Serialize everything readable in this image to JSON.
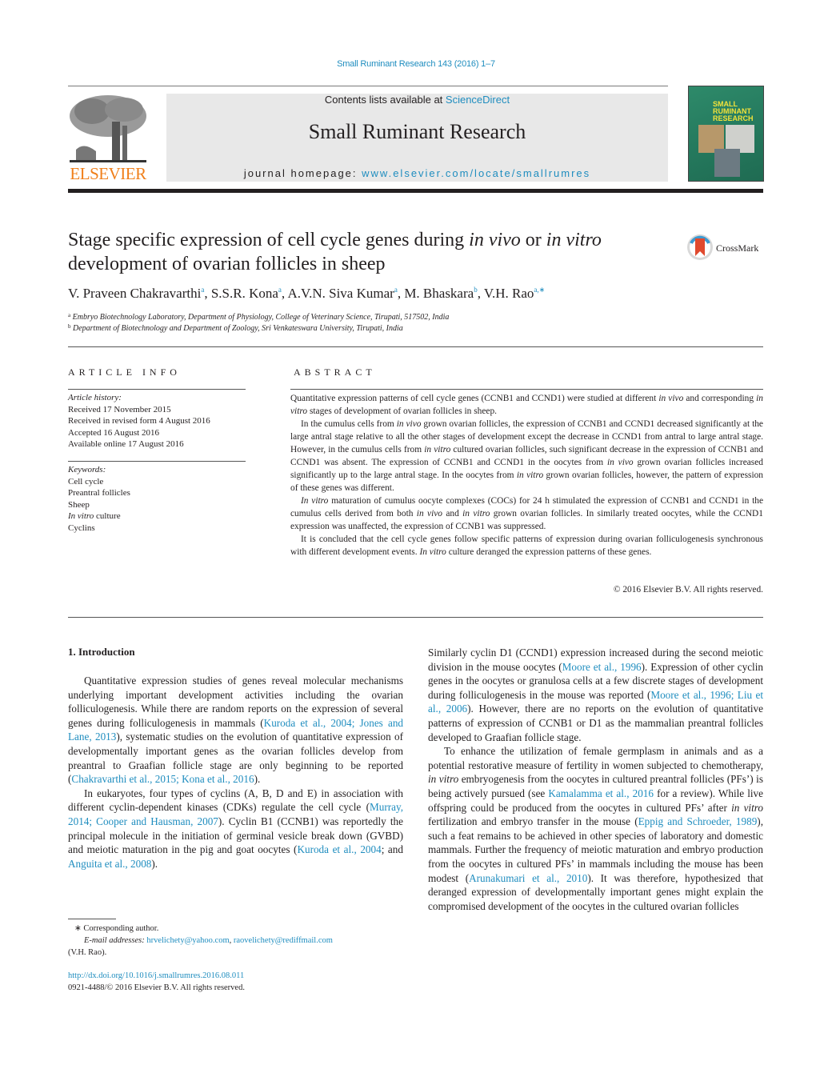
{
  "header": {
    "journal_ref": "Small Ruminant Research 143 (2016) 1–7",
    "contents_prefix": "Contents lists available at ",
    "contents_link": "ScienceDirect",
    "journal_name": "Small Ruminant Research",
    "homepage_prefix": "journal homepage: ",
    "homepage_link": "www.elsevier.com/locate/smallrumres",
    "publisher_logo_text": "ELSEVIER",
    "cover_title_lines": [
      "SMALL",
      "RUMINANT",
      "RESEARCH"
    ],
    "colors": {
      "link": "#1f8dbf",
      "elsevier_orange": "#f07f1a",
      "cover_green": "#257a5e",
      "cover_title": "#f2e23a"
    }
  },
  "article": {
    "title_part1": "Stage specific expression of cell cycle genes during ",
    "title_italic1": "in vivo",
    "title_part2": " or ",
    "title_italic2": "in vitro",
    "title_line2": "development of ovarian follicles in sheep",
    "crossmark_label": "CrossMark",
    "authors": [
      {
        "name": "V. Praveen Chakravarthi",
        "sup": "a"
      },
      {
        "name": "S.S.R. Kona",
        "sup": "a"
      },
      {
        "name": "A.V.N. Siva Kumar",
        "sup": "a"
      },
      {
        "name": "M. Bhaskara",
        "sup": "b"
      },
      {
        "name": "V.H. Rao",
        "sup": "a,∗"
      }
    ],
    "affiliations": [
      {
        "sup": "a",
        "text": "Embryo Biotechnology Laboratory, Department of Physiology, College of Veterinary Science, Tirupati, 517502, India"
      },
      {
        "sup": "b",
        "text": "Department of Biotechnology and Department of Zoology, Sri Venkateswara University, Tirupati, India"
      }
    ]
  },
  "article_info": {
    "heading": "ARTICLE INFO",
    "history_label": "Article history:",
    "history": [
      "Received 17 November 2015",
      "Received in revised form 4 August 2016",
      "Accepted 16 August 2016",
      "Available online 17 August 2016"
    ],
    "keywords_label": "Keywords:",
    "keywords": [
      "Cell cycle",
      "Preantral follicles",
      "Sheep",
      "In vitro culture",
      "Cyclins"
    ]
  },
  "abstract": {
    "heading": "ABSTRACT",
    "copyright": "© 2016 Elsevier B.V. All rights reserved."
  },
  "intro": {
    "heading": "1.  Introduction"
  },
  "footnote": {
    "corresponding": "∗  Corresponding author.",
    "email_label": "E-mail addresses:",
    "email1": "hrvelichety@yahoo.com",
    "email2": "raovelichety@rediffmail.com",
    "email_owner": "(V.H. Rao).",
    "doi": "http://dx.doi.org/10.1016/j.smallrumres.2016.08.011",
    "issn": "0921-4488/© 2016 Elsevier B.V. All rights reserved."
  }
}
